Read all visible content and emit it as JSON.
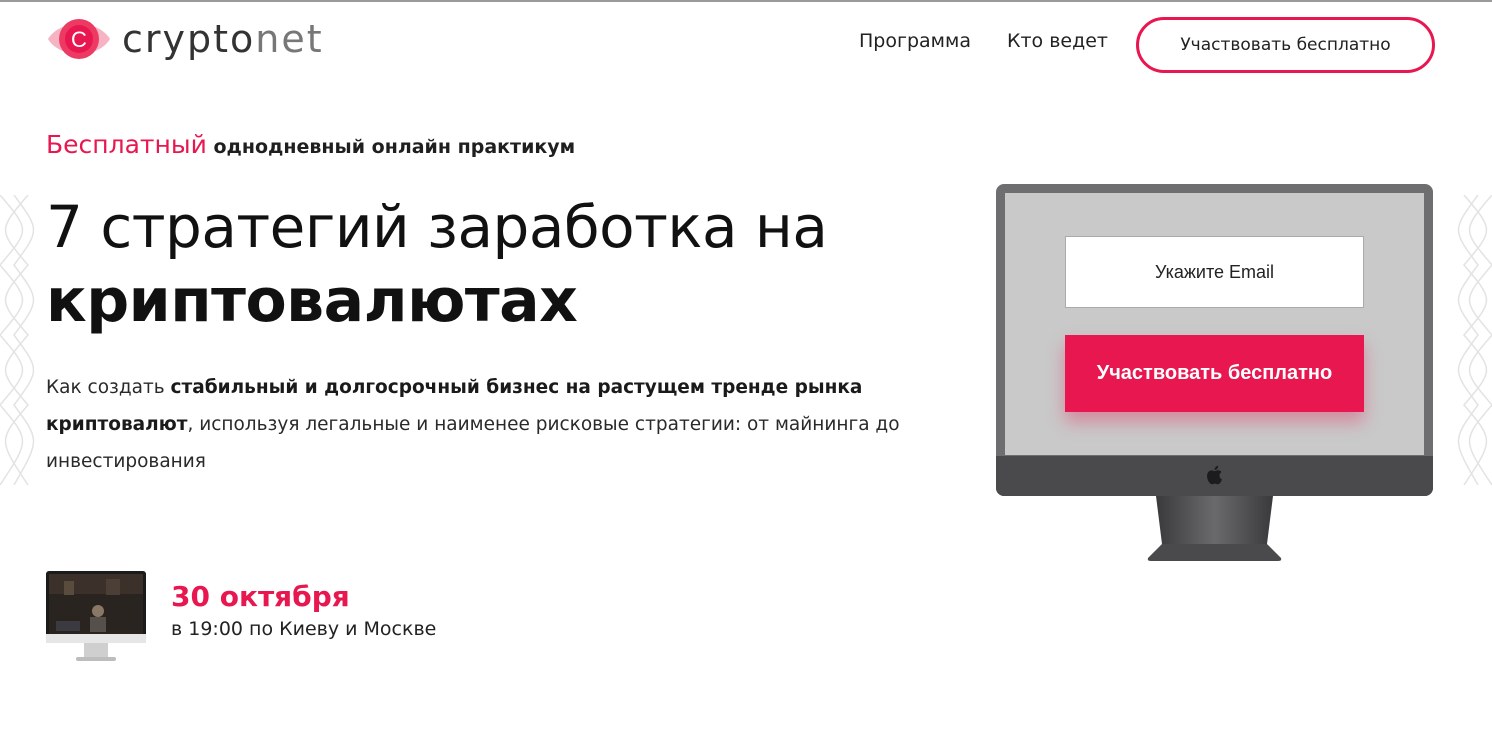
{
  "colors": {
    "accent": "#e8174f",
    "text": "#1a1a1a",
    "monitor_frame": "#6e6e70",
    "screen": "#c9c9c9"
  },
  "header": {
    "logo_letter": "C",
    "logo_text_1": "crypto",
    "logo_text_2": "net",
    "nav": [
      {
        "label": "Программа"
      },
      {
        "label": "Кто ведет"
      }
    ],
    "cta_label": "Участвовать бесплатно"
  },
  "hero": {
    "eyebrow_accent": "Бесплатный",
    "eyebrow_rest": " однодневный онлайн практикум",
    "title_line1": "7 стратегий заработка на",
    "title_line2": "криптовалютах",
    "desc_1": "Как создать ",
    "desc_2": "стабильный и долгосрочный бизнес на растущем тренде рынка криптовалют",
    "desc_3": ", используя легальные и наименее рисковые стратегии: от майнинга до инвестирования"
  },
  "event": {
    "date": "30 октября",
    "time": "в 19:00 по Киеву и Москве"
  },
  "form": {
    "email_placeholder": "Укажите Email",
    "submit_label": "Участвовать бесплатно"
  },
  "icons": [
    "logo-eye-icon",
    "apple-icon",
    "monitor-icon",
    "decorative-pattern-icon"
  ]
}
